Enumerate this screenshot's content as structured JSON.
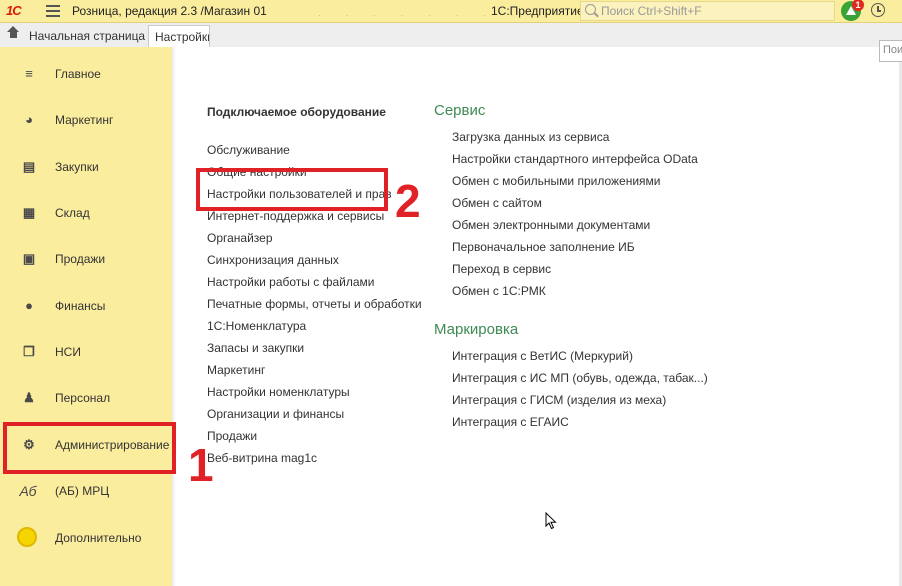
{
  "titlebar": {
    "logo": "1С",
    "title": "Розница, редакция 2.3 /Магазин 01",
    "platform": "1С:Предприятие",
    "search_placeholder": "Поиск Ctrl+Shift+F",
    "notification_count": "1"
  },
  "tabs": {
    "home_label": "Начальная страница",
    "active_label": "Настройки"
  },
  "sidebar": {
    "items": [
      {
        "label": "Главное",
        "icon": "menu-list-icon"
      },
      {
        "label": "Маркетинг",
        "icon": "pie-chart-icon"
      },
      {
        "label": "Закупки",
        "icon": "cart-icon"
      },
      {
        "label": "Склад",
        "icon": "grid-icon"
      },
      {
        "label": "Продажи",
        "icon": "basket-icon"
      },
      {
        "label": "Финансы",
        "icon": "coin-icon"
      },
      {
        "label": "НСИ",
        "icon": "documents-icon"
      },
      {
        "label": "Персонал",
        "icon": "person-icon"
      },
      {
        "label": "Администрирование",
        "icon": "gear-icon"
      },
      {
        "label": "(АБ) МРЦ",
        "icon": "ab-icon"
      },
      {
        "label": "Дополнительно",
        "icon": "sun-icon"
      }
    ]
  },
  "main": {
    "search_stub": "Поис",
    "left_heading": "Подключаемое оборудование",
    "left_links": [
      "Обслуживание",
      "Общие настройки",
      "Настройки пользователей и прав",
      "Интернет-поддержка и сервисы",
      "Органайзер",
      "Синхронизация данных",
      "Настройки работы с файлами",
      "Печатные формы, отчеты и обработки",
      "1С:Номенклатура",
      "Запасы и закупки",
      "Маркетинг",
      "Настройки номенклатуры",
      "Организации и финансы",
      "Продажи",
      "Веб-витрина mag1c"
    ],
    "service_heading": "Сервис",
    "service_links": [
      "Загрузка данных из сервиса",
      "Настройки стандартного интерфейса OData",
      "Обмен с мобильными приложениями",
      "Обмен с сайтом",
      "Обмен электронными документами",
      "Первоначальное заполнение ИБ",
      "Переход в сервис",
      "Обмен с 1С:РМК"
    ],
    "marking_heading": "Маркировка",
    "marking_links": [
      "Интеграция с ВетИС (Меркурий)",
      "Интеграция с ИС МП (обувь, одежда, табак...)",
      "Интеграция с ГИСМ (изделия из меха)",
      "Интеграция с ЕГАИС"
    ]
  },
  "annotations": {
    "one": "1",
    "two": "2",
    "color": "#e02227"
  },
  "colors": {
    "sidebar_bg": "#fbed9e",
    "section_heading": "#3f8a56"
  }
}
